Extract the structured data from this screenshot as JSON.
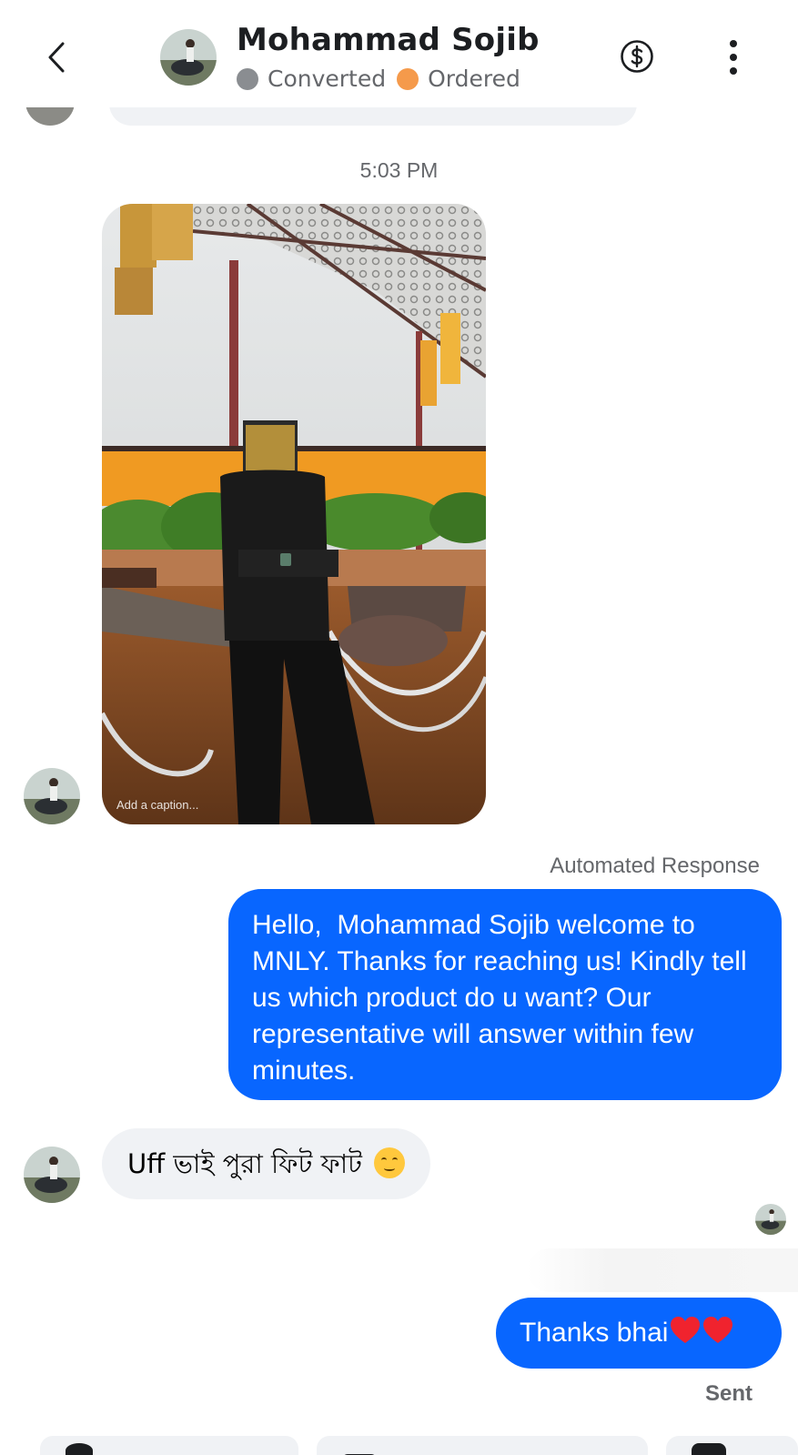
{
  "header": {
    "name": "Mohammad Sojib",
    "tags": [
      {
        "label": "Converted",
        "color": "#8a8d91"
      },
      {
        "label": "Ordered",
        "color": "#f59a4b"
      }
    ],
    "back_icon": "chevron-left-icon",
    "payment_icon": "dollar-circle-icon",
    "more_icon": "more-vertical-icon"
  },
  "thread": {
    "timestamp": "5:03 PM",
    "photo_caption": "Add a caption...",
    "automated_label": "Automated Response",
    "messages": [
      {
        "direction": "outgoing",
        "text": "Hello,  Mohammad Sojib welcome to MNLY. Thanks for reaching us! Kindly tell us which product do u want? Our representative will answer within few minutes."
      },
      {
        "direction": "incoming",
        "text": "Uff ভাই পুরা ফিট ফাট",
        "emoji": "face-savoring-food"
      },
      {
        "direction": "outgoing",
        "text": "Thanks bhai",
        "emoji": "red-heart x2"
      }
    ],
    "status": "Sent"
  },
  "colors": {
    "outgoing_bubble": "#0866ff",
    "incoming_bubble": "#f0f2f5"
  }
}
